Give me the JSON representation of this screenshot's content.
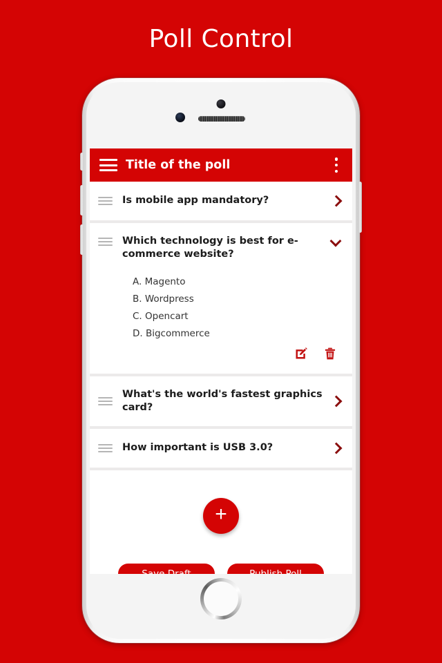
{
  "page": {
    "title": "Poll Control",
    "background_color": "#d40404",
    "accent_color": "#d40404"
  },
  "device": {
    "name": "smartphone-mockup",
    "camera": "front-camera",
    "speaker": "earpiece-speaker",
    "home_button": "home-button"
  },
  "appbar": {
    "menu_icon": "hamburger-menu-icon",
    "title": "Title of the poll",
    "overflow_icon": "kebab-menu-icon"
  },
  "questions": [
    {
      "drag_icon": "drag-handle-icon",
      "text": "Is mobile app mandatory?",
      "expanded": false,
      "chevron_icon": "chevron-right-icon",
      "options": []
    },
    {
      "drag_icon": "drag-handle-icon",
      "text": "Which technology is best for e-commerce website?",
      "expanded": true,
      "chevron_icon": "chevron-down-icon",
      "options": [
        "A. Magento",
        "B. Wordpress",
        "C. Opencart",
        "D. Bigcommerce"
      ],
      "edit_icon": "edit-pencil-icon",
      "delete_icon": "trash-delete-icon"
    },
    {
      "drag_icon": "drag-handle-icon",
      "text": "What's the world's fastest graphics card?",
      "expanded": false,
      "chevron_icon": "chevron-right-icon",
      "options": []
    },
    {
      "drag_icon": "drag-handle-icon",
      "text": "How important is USB 3.0?",
      "expanded": false,
      "chevron_icon": "chevron-right-icon",
      "options": []
    }
  ],
  "footer": {
    "add_button_label": "+",
    "add_button_icon": "plus-icon",
    "save_draft_label": "Save Draft",
    "publish_poll_label": "Publish Poll"
  }
}
